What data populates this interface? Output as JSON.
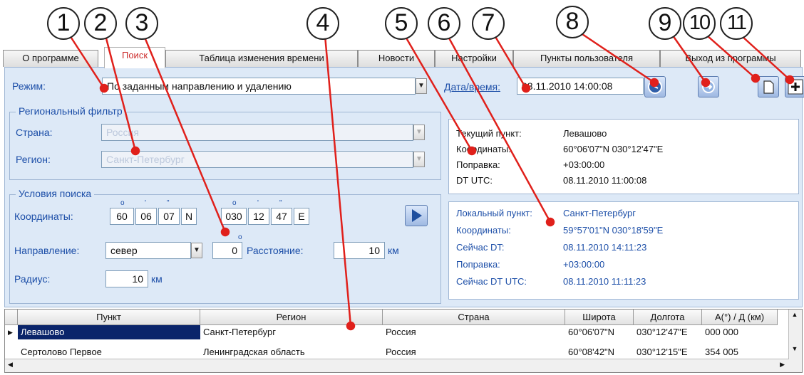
{
  "callouts": [
    "1",
    "2",
    "3",
    "4",
    "5",
    "6",
    "7",
    "8",
    "9",
    "10",
    "11"
  ],
  "tabs": [
    "О программе",
    "Поиск",
    "Таблица изменения времени",
    "Новости",
    "Настройки",
    "Пункты пользователя",
    "Выход из программы"
  ],
  "mode": {
    "label": "Режим:",
    "value": "По заданным направлению и удалению"
  },
  "datetime": {
    "label": "Дата/время:",
    "value": "08.11.2010 14:00:08"
  },
  "icons": {
    "clock": "clock-icon",
    "arrow": "arrow-icon",
    "doc": "new-document-icon",
    "add": "add-icon"
  },
  "region_filter": {
    "title": "Региональный фильтр",
    "country_label": "Страна:",
    "country_value": "Россия",
    "region_label": "Регион:",
    "region_value": "Санкт-Петербург"
  },
  "search": {
    "title": "Условия поиска",
    "coords_label": "Координаты:",
    "lat": [
      "60",
      "06",
      "07",
      "N"
    ],
    "lon": [
      "030",
      "12",
      "47",
      "E"
    ],
    "tick_deg": "o",
    "tick_min": "'",
    "tick_sec": "\"",
    "direction_label": "Направление:",
    "direction_value": "север",
    "angle_value": "0",
    "angle_unit": "o",
    "distance_label": "Расстояние:",
    "distance_value": "10",
    "distance_unit": "км",
    "radius_label": "Радиус:",
    "radius_value": "10",
    "radius_unit": "км"
  },
  "current": {
    "rows": [
      {
        "label": "Текущий пункт:",
        "value": "Левашово"
      },
      {
        "label": "Координаты:",
        "value": "60°06'07\"N  030°12'47\"E"
      },
      {
        "label": "Поправка:",
        "value": "+03:00:00"
      },
      {
        "label": "DT UTC:",
        "value": "08.11.2010 11:00:08"
      }
    ]
  },
  "local": {
    "rows": [
      {
        "label": "Локальный пункт:",
        "value": "Санкт-Петербург"
      },
      {
        "label": "Координаты:",
        "value": "59°57'01\"N  030°18'59\"E"
      },
      {
        "label": "Сейчас DT:",
        "value": "08.11.2010 14:11:23"
      },
      {
        "label": "Поправка:",
        "value": "+03:00:00"
      },
      {
        "label": "Сейчас DT UTC:",
        "value": "08.11.2010 11:11:23"
      }
    ]
  },
  "table": {
    "columns": [
      "Пункт",
      "Регион",
      "Страна",
      "Широта",
      "Долгота",
      "А(°) / Д (км)"
    ],
    "rows": [
      [
        "Левашово",
        "Санкт-Петербург",
        "Россия",
        "60°06'07\"N",
        "030°12'47\"E",
        "000  000"
      ],
      [
        "Сертолово Первое",
        "Ленинградская область",
        "Россия",
        "60°08'42\"N",
        "030°12'15\"E",
        "354  005"
      ]
    ]
  }
}
